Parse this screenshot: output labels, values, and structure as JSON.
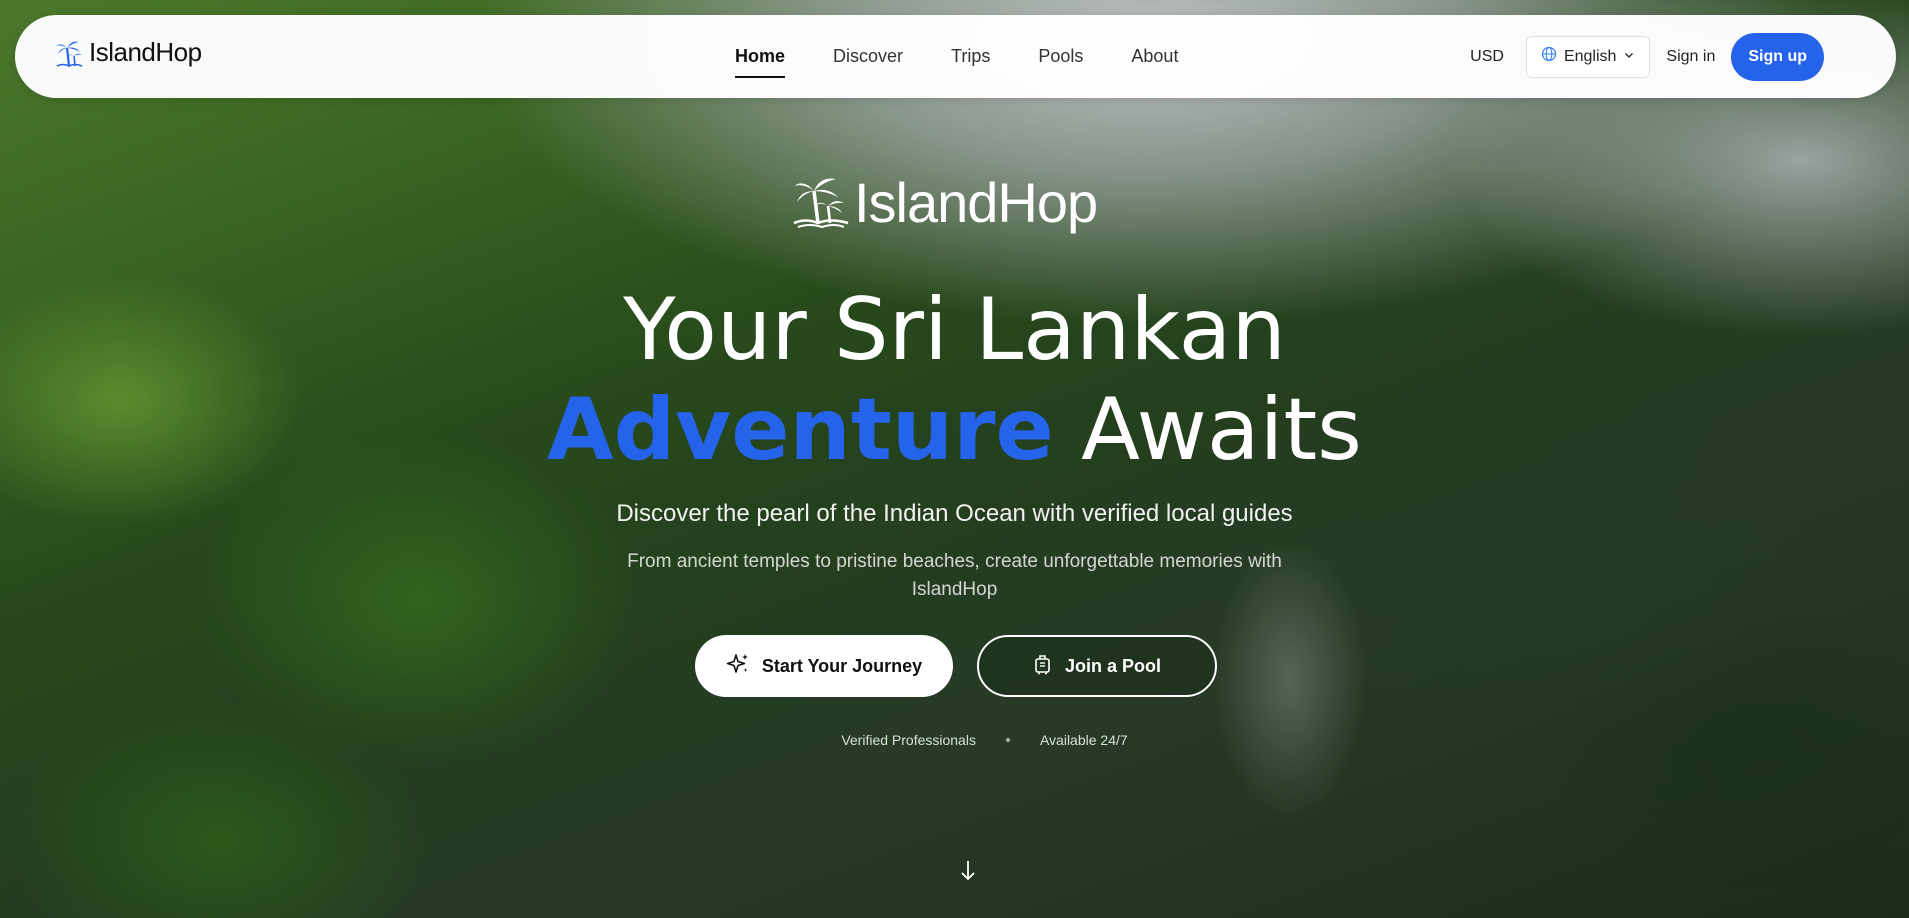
{
  "navbar": {
    "brand": "IslandHop",
    "links": [
      {
        "label": "Home",
        "active": true
      },
      {
        "label": "Discover",
        "active": false
      },
      {
        "label": "Trips",
        "active": false
      },
      {
        "label": "Pools",
        "active": false
      },
      {
        "label": "About",
        "active": false
      }
    ],
    "currency": "USD",
    "language": "English",
    "signin_label": "Sign in",
    "signup_label": "Sign up"
  },
  "hero": {
    "logo_text": "IslandHop",
    "headline_line1": "Your Sri Lankan",
    "headline_accent": "Adventure",
    "headline_rest": "Awaits",
    "subtitle": "Discover the pearl of the Indian Ocean with verified local guides",
    "description": "From ancient temples to pristine beaches, create unforgettable memories with IslandHop",
    "primary_button": "Start Your Journey",
    "secondary_button": "Join a Pool",
    "features": [
      "Verified Professionals",
      "Available 24/7"
    ]
  },
  "icons": {
    "brand_logo": "palm-tree-icon",
    "language": "globe-icon",
    "language_dropdown": "chevron-down-icon",
    "primary_button": "sparkles-icon",
    "secondary_button": "luggage-icon",
    "scroll": "arrow-down-icon"
  },
  "colors": {
    "accent": "#2563eb",
    "signup_bg": "#2563eb",
    "navbar_bg": "#ffffff",
    "text_dark": "#111111"
  }
}
